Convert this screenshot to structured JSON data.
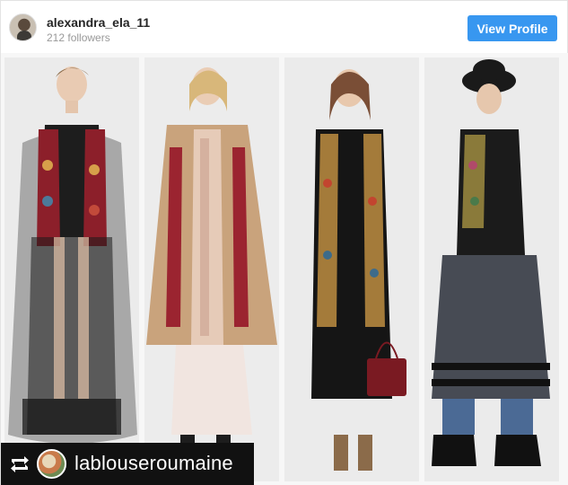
{
  "post": {
    "username": "alexandra_ela_11",
    "followers": "212 followers",
    "view_profile_label": "View Profile",
    "accent_color": "#3897f0"
  },
  "photo": {
    "description_panels": 4
  },
  "repost": {
    "icon": "repost-icon",
    "account": "lablouseroumaine"
  }
}
